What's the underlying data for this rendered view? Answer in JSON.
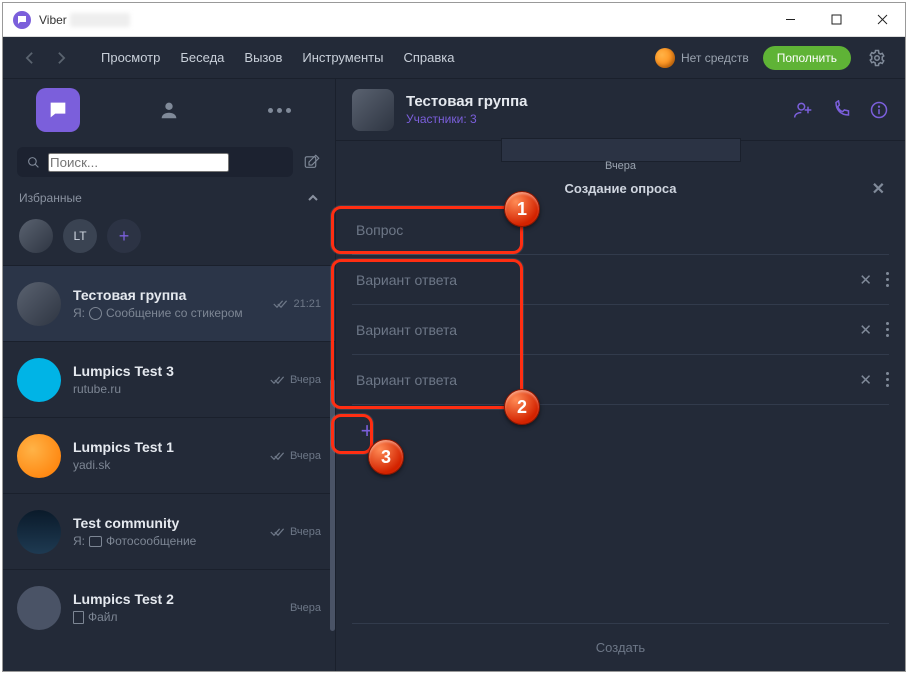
{
  "window": {
    "title": "Viber"
  },
  "menubar": {
    "items": [
      "Просмотр",
      "Беседа",
      "Вызов",
      "Инструменты",
      "Справка"
    ],
    "balance_label": "Нет средств",
    "topup_label": "Пополнить"
  },
  "sidebar": {
    "search_placeholder": "Поиск...",
    "favorites_label": "Избранные",
    "fav_items": [
      {
        "label": ""
      },
      {
        "label": "LT"
      }
    ],
    "chats": [
      {
        "name": "Тестовая группа",
        "sub_prefix": "Я:",
        "sub": "Сообщение со стикером",
        "time": "21:21",
        "checks": true,
        "icon": "smiley",
        "avatar": "img1",
        "active": true
      },
      {
        "name": "Lumpics Test 3",
        "sub_prefix": "",
        "sub": "rutube.ru",
        "time": "Вчера",
        "checks": true,
        "icon": "",
        "avatar": "cyan",
        "active": false
      },
      {
        "name": "Lumpics Test 1",
        "sub_prefix": "",
        "sub": "yadi.sk",
        "time": "Вчера",
        "checks": true,
        "icon": "",
        "avatar": "orange",
        "active": false
      },
      {
        "name": "Test community",
        "sub_prefix": "Я:",
        "sub": "Фотосообщение",
        "time": "Вчера",
        "checks": true,
        "icon": "camera",
        "avatar": "dark",
        "active": false
      },
      {
        "name": "Lumpics Test 2",
        "sub_prefix": "",
        "sub": "Файл",
        "time": "Вчера",
        "checks": false,
        "icon": "file",
        "avatar": "grey",
        "active": false
      }
    ]
  },
  "chat_header": {
    "title": "Тестовая группа",
    "members": "Участники: 3"
  },
  "strip": {
    "date": "Вчера"
  },
  "poll": {
    "title": "Создание опроса",
    "question_placeholder": "Вопрос",
    "option_placeholder": "Вариант ответа",
    "create_label": "Создать"
  },
  "callouts": {
    "c1": "1",
    "c2": "2",
    "c3": "3"
  }
}
